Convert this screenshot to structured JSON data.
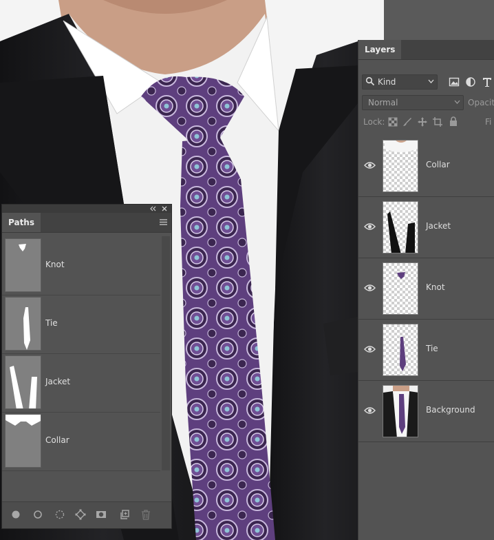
{
  "layers_panel": {
    "tab": "Layers",
    "filter_kind": "Kind",
    "blend_mode": "Normal",
    "opacity_label": "Opacity",
    "lock_label": "Lock:",
    "fill_label": "Fi",
    "layers": [
      {
        "name": "Collar"
      },
      {
        "name": "Jacket"
      },
      {
        "name": "Knot"
      },
      {
        "name": "Tie"
      },
      {
        "name": "Background"
      }
    ]
  },
  "paths_panel": {
    "tab": "Paths",
    "paths": [
      {
        "name": "Knot"
      },
      {
        "name": "Tie"
      },
      {
        "name": "Jacket"
      },
      {
        "name": "Collar"
      }
    ]
  },
  "colors": {
    "panel_bg": "#535353",
    "tie_purple": "#6a4a8a",
    "jacket_black": "#1c1c1e",
    "shirt_white": "#f2f2f2"
  }
}
